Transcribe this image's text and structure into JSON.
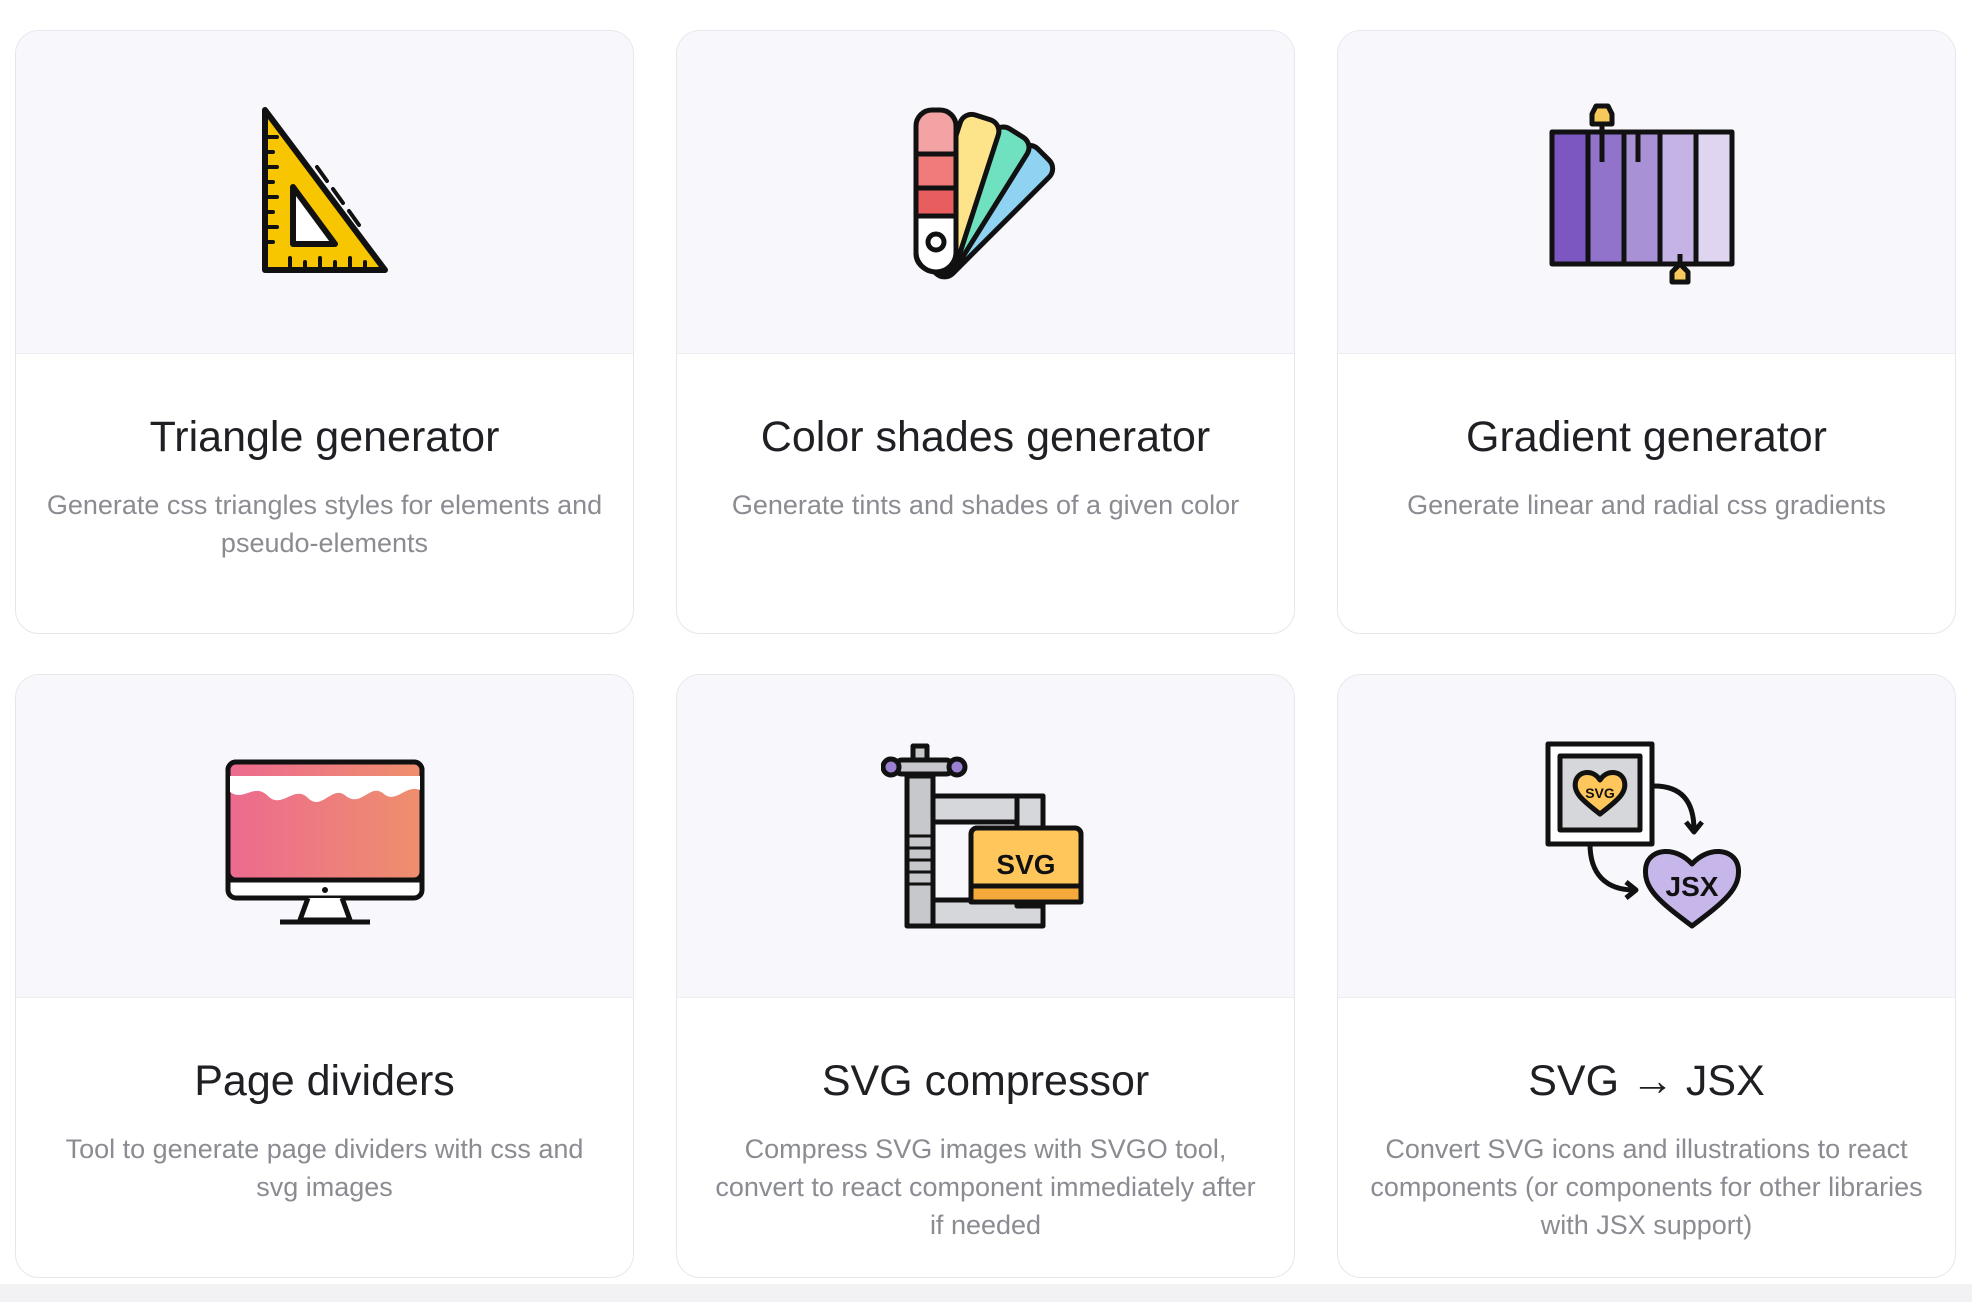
{
  "cards": [
    {
      "title": "Triangle generator",
      "description": "Generate css triangles styles for elements and pseudo-elements",
      "icon": "set-square-icon",
      "accent": "#f7c600"
    },
    {
      "title": "Color shades generator",
      "description": "Generate tints and shades of a given color",
      "icon": "color-swatches-icon",
      "accent": "#f08b8b"
    },
    {
      "title": "Gradient generator",
      "description": "Generate linear and radial css gradients",
      "icon": "gradient-bars-icon",
      "accent": "#7d57c1"
    },
    {
      "title": "Page dividers",
      "description": "Tool to generate page dividers with css and svg images",
      "icon": "monitor-wave-icon",
      "accent": "#ec7b93"
    },
    {
      "title": "SVG compressor",
      "description": "Compress SVG images with SVGO tool, convert to react component immediately after if needed",
      "icon": "svg-clamp-icon",
      "accent": "#ffc65c",
      "icon_text": "SVG"
    },
    {
      "title": "SVG → JSX",
      "description": "Convert SVG icons and illustrations to react components (or components for other libraries with JSX support)",
      "icon": "svg-to-jsx-icon",
      "accent": "#c6b6ea",
      "icon_text_from": "SVG",
      "icon_text_to": "JSX"
    }
  ]
}
